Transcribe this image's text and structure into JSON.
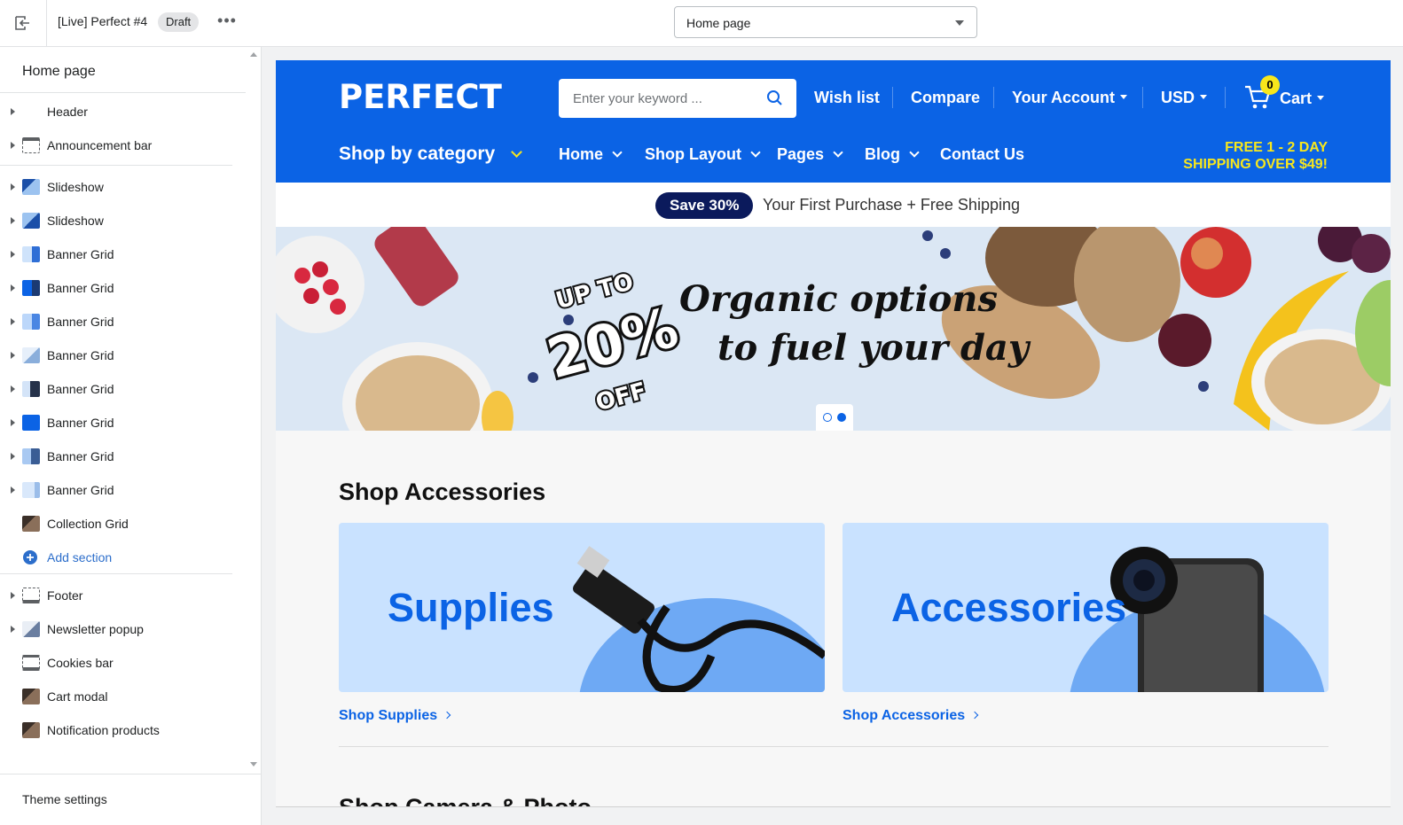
{
  "topbar": {
    "theme_name": "[Live] Perfect #4",
    "draft": "Draft",
    "more": "•••",
    "page_select": "Home page"
  },
  "sidebar": {
    "title": "Home page",
    "header_item": "Header",
    "announcement_item": "Announcement bar",
    "sections": [
      {
        "label": "Slideshow"
      },
      {
        "label": "Slideshow"
      },
      {
        "label": "Banner Grid"
      },
      {
        "label": "Banner Grid"
      },
      {
        "label": "Banner Grid"
      },
      {
        "label": "Banner Grid"
      },
      {
        "label": "Banner Grid"
      },
      {
        "label": "Banner Grid"
      },
      {
        "label": "Banner Grid"
      },
      {
        "label": "Banner Grid"
      },
      {
        "label": "Collection Grid"
      }
    ],
    "add_section": "Add section",
    "footer_items": [
      {
        "label": "Footer"
      },
      {
        "label": "Newsletter popup"
      },
      {
        "label": "Cookies bar"
      },
      {
        "label": "Cart modal"
      },
      {
        "label": "Notification products"
      }
    ],
    "theme_settings": "Theme settings"
  },
  "store": {
    "logo": "PERFECT",
    "search_placeholder": "Enter your keyword ...",
    "wishlist": "Wish list",
    "compare": "Compare",
    "account": "Your Account",
    "currency": "USD",
    "cart_count": "0",
    "cart": "Cart",
    "shop_by_category": "Shop by category",
    "nav": [
      "Home",
      "Shop Layout",
      "Pages",
      "Blog",
      "Contact Us"
    ],
    "free_ship_line1": "FREE 1 - 2 DAY",
    "free_ship_line2": "SHIPPING OVER $49!",
    "brand_color": "#0b63e5",
    "accent_color": "#f8e71c"
  },
  "announcement": {
    "badge": "Save 30%",
    "text": "Your First Purchase + Free Shipping"
  },
  "slideshow": {
    "promo_line1": "UP TO",
    "promo_line2": "20%",
    "promo_line3": "OFF",
    "headline_line1": "Organic options",
    "headline_line2": "to fuel your day"
  },
  "accessories": {
    "title": "Shop Accessories",
    "cards": [
      {
        "title": "Supplies",
        "link": "Shop Supplies"
      },
      {
        "title": "Accessories",
        "link": "Shop Accessories"
      }
    ],
    "next_title": "Shop Camera & Photo"
  }
}
